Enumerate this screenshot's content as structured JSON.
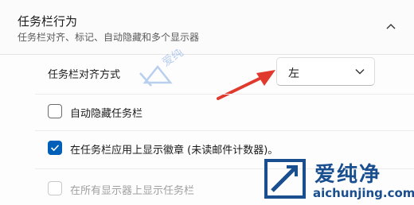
{
  "section": {
    "title": "任务栏行为",
    "subtitle": "任务栏对齐、标记、自动隐藏和多个显示器"
  },
  "alignment": {
    "label": "任务栏对齐方式",
    "selected": "左"
  },
  "options": [
    {
      "label": "自动隐藏任务栏",
      "checked": false,
      "disabled": false
    },
    {
      "label": "在任务栏应用上显示徽章 (未读邮件计数器)。",
      "checked": true,
      "disabled": false
    },
    {
      "label": "在所有显示器上显示任务栏",
      "checked": false,
      "disabled": true
    }
  ],
  "watermark": {
    "brand": "爱纯净",
    "url": "aichunjing.com"
  },
  "colors": {
    "accent": "#005fb8",
    "arrow": "#e03a2f",
    "watermark": "#1a4f8f"
  }
}
